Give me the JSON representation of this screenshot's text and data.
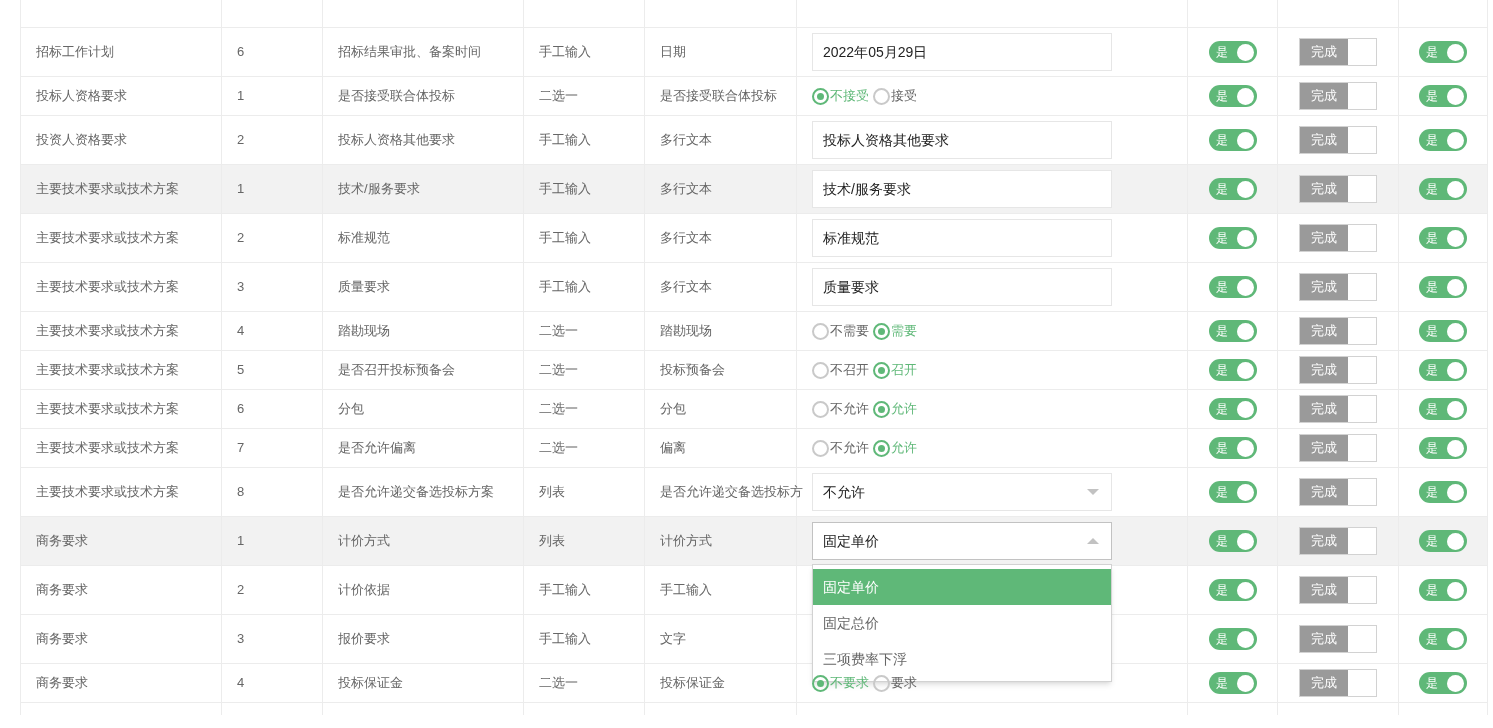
{
  "rows": [
    {
      "category": "招标工作计划",
      "index": "6",
      "name": "招标结果审批、备案时间",
      "input_mode": "手工输入",
      "field_type": "日期",
      "value": {
        "kind": "input",
        "value": "2022年05月29日"
      },
      "toggle_a": {
        "label": "是",
        "on": true
      },
      "status": {
        "label": "完成",
        "on": true,
        "disabled": true
      },
      "toggle_b": {
        "label": "是",
        "on": true
      },
      "shaded": false
    },
    {
      "category": "投标人资格要求",
      "index": "1",
      "name": "是否接受联合体投标",
      "input_mode": "二选一",
      "field_type": "是否接受联合体投标",
      "value": {
        "kind": "radio",
        "options": [
          {
            "label": "不接受",
            "selected": true
          },
          {
            "label": "接受",
            "selected": false
          }
        ]
      },
      "toggle_a": {
        "label": "是",
        "on": true
      },
      "status": {
        "label": "完成",
        "on": true,
        "disabled": true
      },
      "toggle_b": {
        "label": "是",
        "on": true
      },
      "shaded": false
    },
    {
      "category": "投资人资格要求",
      "index": "2",
      "name": "投标人资格其他要求",
      "input_mode": "手工输入",
      "field_type": "多行文本",
      "value": {
        "kind": "input",
        "value": "投标人资格其他要求"
      },
      "toggle_a": {
        "label": "是",
        "on": true
      },
      "status": {
        "label": "完成",
        "on": true,
        "disabled": true
      },
      "toggle_b": {
        "label": "是",
        "on": true
      },
      "shaded": false
    },
    {
      "category": "主要技术要求或技术方案",
      "index": "1",
      "name": "技术/服务要求",
      "input_mode": "手工输入",
      "field_type": "多行文本",
      "value": {
        "kind": "input",
        "value": "技术/服务要求"
      },
      "toggle_a": {
        "label": "是",
        "on": true
      },
      "status": {
        "label": "完成",
        "on": true,
        "disabled": true
      },
      "toggle_b": {
        "label": "是",
        "on": true
      },
      "shaded": true
    },
    {
      "category": "主要技术要求或技术方案",
      "index": "2",
      "name": "标准规范",
      "input_mode": "手工输入",
      "field_type": "多行文本",
      "value": {
        "kind": "input",
        "value": "标准规范"
      },
      "toggle_a": {
        "label": "是",
        "on": true
      },
      "status": {
        "label": "完成",
        "on": true,
        "disabled": true
      },
      "toggle_b": {
        "label": "是",
        "on": true
      },
      "shaded": false
    },
    {
      "category": "主要技术要求或技术方案",
      "index": "3",
      "name": "质量要求",
      "input_mode": "手工输入",
      "field_type": "多行文本",
      "value": {
        "kind": "input",
        "value": "质量要求"
      },
      "toggle_a": {
        "label": "是",
        "on": true
      },
      "status": {
        "label": "完成",
        "on": true,
        "disabled": true
      },
      "toggle_b": {
        "label": "是",
        "on": true
      },
      "shaded": false
    },
    {
      "category": "主要技术要求或技术方案",
      "index": "4",
      "name": "踏勘现场",
      "input_mode": "二选一",
      "field_type": "踏勘现场",
      "value": {
        "kind": "radio",
        "options": [
          {
            "label": "不需要",
            "selected": false
          },
          {
            "label": "需要",
            "selected": true
          }
        ]
      },
      "toggle_a": {
        "label": "是",
        "on": true
      },
      "status": {
        "label": "完成",
        "on": true,
        "disabled": true
      },
      "toggle_b": {
        "label": "是",
        "on": true
      },
      "shaded": false
    },
    {
      "category": "主要技术要求或技术方案",
      "index": "5",
      "name": "是否召开投标预备会",
      "input_mode": "二选一",
      "field_type": "投标预备会",
      "value": {
        "kind": "radio",
        "options": [
          {
            "label": "不召开",
            "selected": false
          },
          {
            "label": "召开",
            "selected": true
          }
        ]
      },
      "toggle_a": {
        "label": "是",
        "on": true
      },
      "status": {
        "label": "完成",
        "on": true,
        "disabled": true
      },
      "toggle_b": {
        "label": "是",
        "on": true
      },
      "shaded": false
    },
    {
      "category": "主要技术要求或技术方案",
      "index": "6",
      "name": "分包",
      "input_mode": "二选一",
      "field_type": "分包",
      "value": {
        "kind": "radio",
        "options": [
          {
            "label": "不允许",
            "selected": false
          },
          {
            "label": "允许",
            "selected": true
          }
        ]
      },
      "toggle_a": {
        "label": "是",
        "on": true
      },
      "status": {
        "label": "完成",
        "on": true,
        "disabled": true
      },
      "toggle_b": {
        "label": "是",
        "on": true
      },
      "shaded": false
    },
    {
      "category": "主要技术要求或技术方案",
      "index": "7",
      "name": "是否允许偏离",
      "input_mode": "二选一",
      "field_type": "偏离",
      "value": {
        "kind": "radio",
        "options": [
          {
            "label": "不允许",
            "selected": false
          },
          {
            "label": "允许",
            "selected": true
          }
        ]
      },
      "toggle_a": {
        "label": "是",
        "on": true
      },
      "status": {
        "label": "完成",
        "on": true,
        "disabled": true
      },
      "toggle_b": {
        "label": "是",
        "on": true
      },
      "shaded": false
    },
    {
      "category": "主要技术要求或技术方案",
      "index": "8",
      "name": "是否允许递交备选投标方案",
      "input_mode": "列表",
      "field_type": "是否允许递交备选投标方",
      "value": {
        "kind": "select",
        "value": "不允许",
        "expanded": false
      },
      "toggle_a": {
        "label": "是",
        "on": true
      },
      "status": {
        "label": "完成",
        "on": true,
        "disabled": true
      },
      "toggle_b": {
        "label": "是",
        "on": true
      },
      "shaded": false
    },
    {
      "category": "商务要求",
      "index": "1",
      "name": "计价方式",
      "input_mode": "列表",
      "field_type": "计价方式",
      "value": {
        "kind": "select",
        "value": "固定单价",
        "expanded": true,
        "options": [
          {
            "label": "固定单价",
            "selected": true
          },
          {
            "label": "固定总价",
            "selected": false
          },
          {
            "label": "三项费率下浮",
            "selected": false
          }
        ]
      },
      "toggle_a": {
        "label": "是",
        "on": true
      },
      "status": {
        "label": "完成",
        "on": true,
        "disabled": true
      },
      "toggle_b": {
        "label": "是",
        "on": true
      },
      "shaded": true
    },
    {
      "category": "商务要求",
      "index": "2",
      "name": "计价依据",
      "input_mode": "手工输入",
      "field_type": "手工输入",
      "value": {
        "kind": "hidden"
      },
      "toggle_a": {
        "label": "是",
        "on": true
      },
      "status": {
        "label": "完成",
        "on": true,
        "disabled": true
      },
      "toggle_b": {
        "label": "是",
        "on": true
      },
      "shaded": false
    },
    {
      "category": "商务要求",
      "index": "3",
      "name": "报价要求",
      "input_mode": "手工输入",
      "field_type": "文字",
      "value": {
        "kind": "hidden"
      },
      "toggle_a": {
        "label": "是",
        "on": true
      },
      "status": {
        "label": "完成",
        "on": true,
        "disabled": true
      },
      "toggle_b": {
        "label": "是",
        "on": true
      },
      "shaded": false
    },
    {
      "category": "商务要求",
      "index": "4",
      "name": "投标保证金",
      "input_mode": "二选一",
      "field_type": "投标保证金",
      "value": {
        "kind": "radio",
        "options": [
          {
            "label": "不要求",
            "selected": true
          },
          {
            "label": "要求",
            "selected": false
          }
        ]
      },
      "toggle_a": {
        "label": "是",
        "on": true
      },
      "status": {
        "label": "完成",
        "on": true,
        "disabled": true
      },
      "toggle_b": {
        "label": "是",
        "on": true
      },
      "shaded": false
    }
  ]
}
